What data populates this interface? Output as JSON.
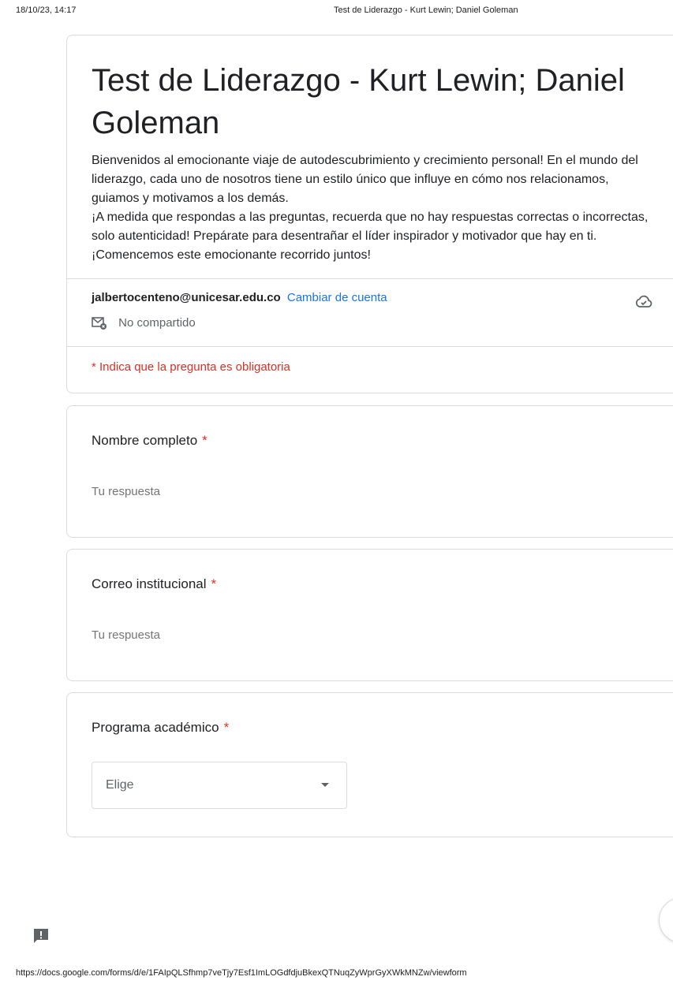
{
  "print_header": {
    "datetime": "18/10/23, 14:17",
    "title": "Test de Liderazgo - Kurt Lewin; Daniel Goleman"
  },
  "form": {
    "title": "Test de Liderazgo - Kurt Lewin; Daniel Goleman",
    "description": "Bienvenidos al emocionante viaje de autodescubrimiento y crecimiento personal! En el mundo del liderazgo, cada uno de nosotros tiene un estilo único que influye en cómo nos relacionamos, guiamos y motivamos a los demás.\n¡A medida que respondas a las preguntas, recuerda que no hay respuestas correctas o incorrectas, solo autenticidad! Prepárate para desentrañar el líder inspirador y motivador que hay en ti. ¡Comencemos este emocionante recorrido juntos!",
    "account_email": "jalbertocenteno@unicesar.edu.co",
    "switch_account": "Cambiar de cuenta",
    "not_shared": "No compartido",
    "required_note": "* Indica que la pregunta es obligatoria"
  },
  "questions": [
    {
      "title": "Nombre completo",
      "required_mark": "*",
      "placeholder": "Tu respuesta"
    },
    {
      "title": "Correo institucional",
      "required_mark": "*",
      "placeholder": "Tu respuesta"
    },
    {
      "title": "Programa académico",
      "required_mark": "*",
      "select_value": "Elige"
    }
  ],
  "icons": {
    "cloud": "cloud-done-icon",
    "mail_off": "mail-not-shared-icon",
    "feedback": "report-feedback-icon",
    "dropdown": "chevron-down-icon"
  },
  "colors": {
    "required": "#d93025",
    "link": "#1a73e8",
    "border": "#dadce0"
  },
  "print_footer": {
    "url": "https://docs.google.com/forms/d/e/1FAIpQLSfhmp7veTjy7Esf1ImLOGdfdjuBkexQTNuqZyWprGyXWkMNZw/viewform"
  }
}
